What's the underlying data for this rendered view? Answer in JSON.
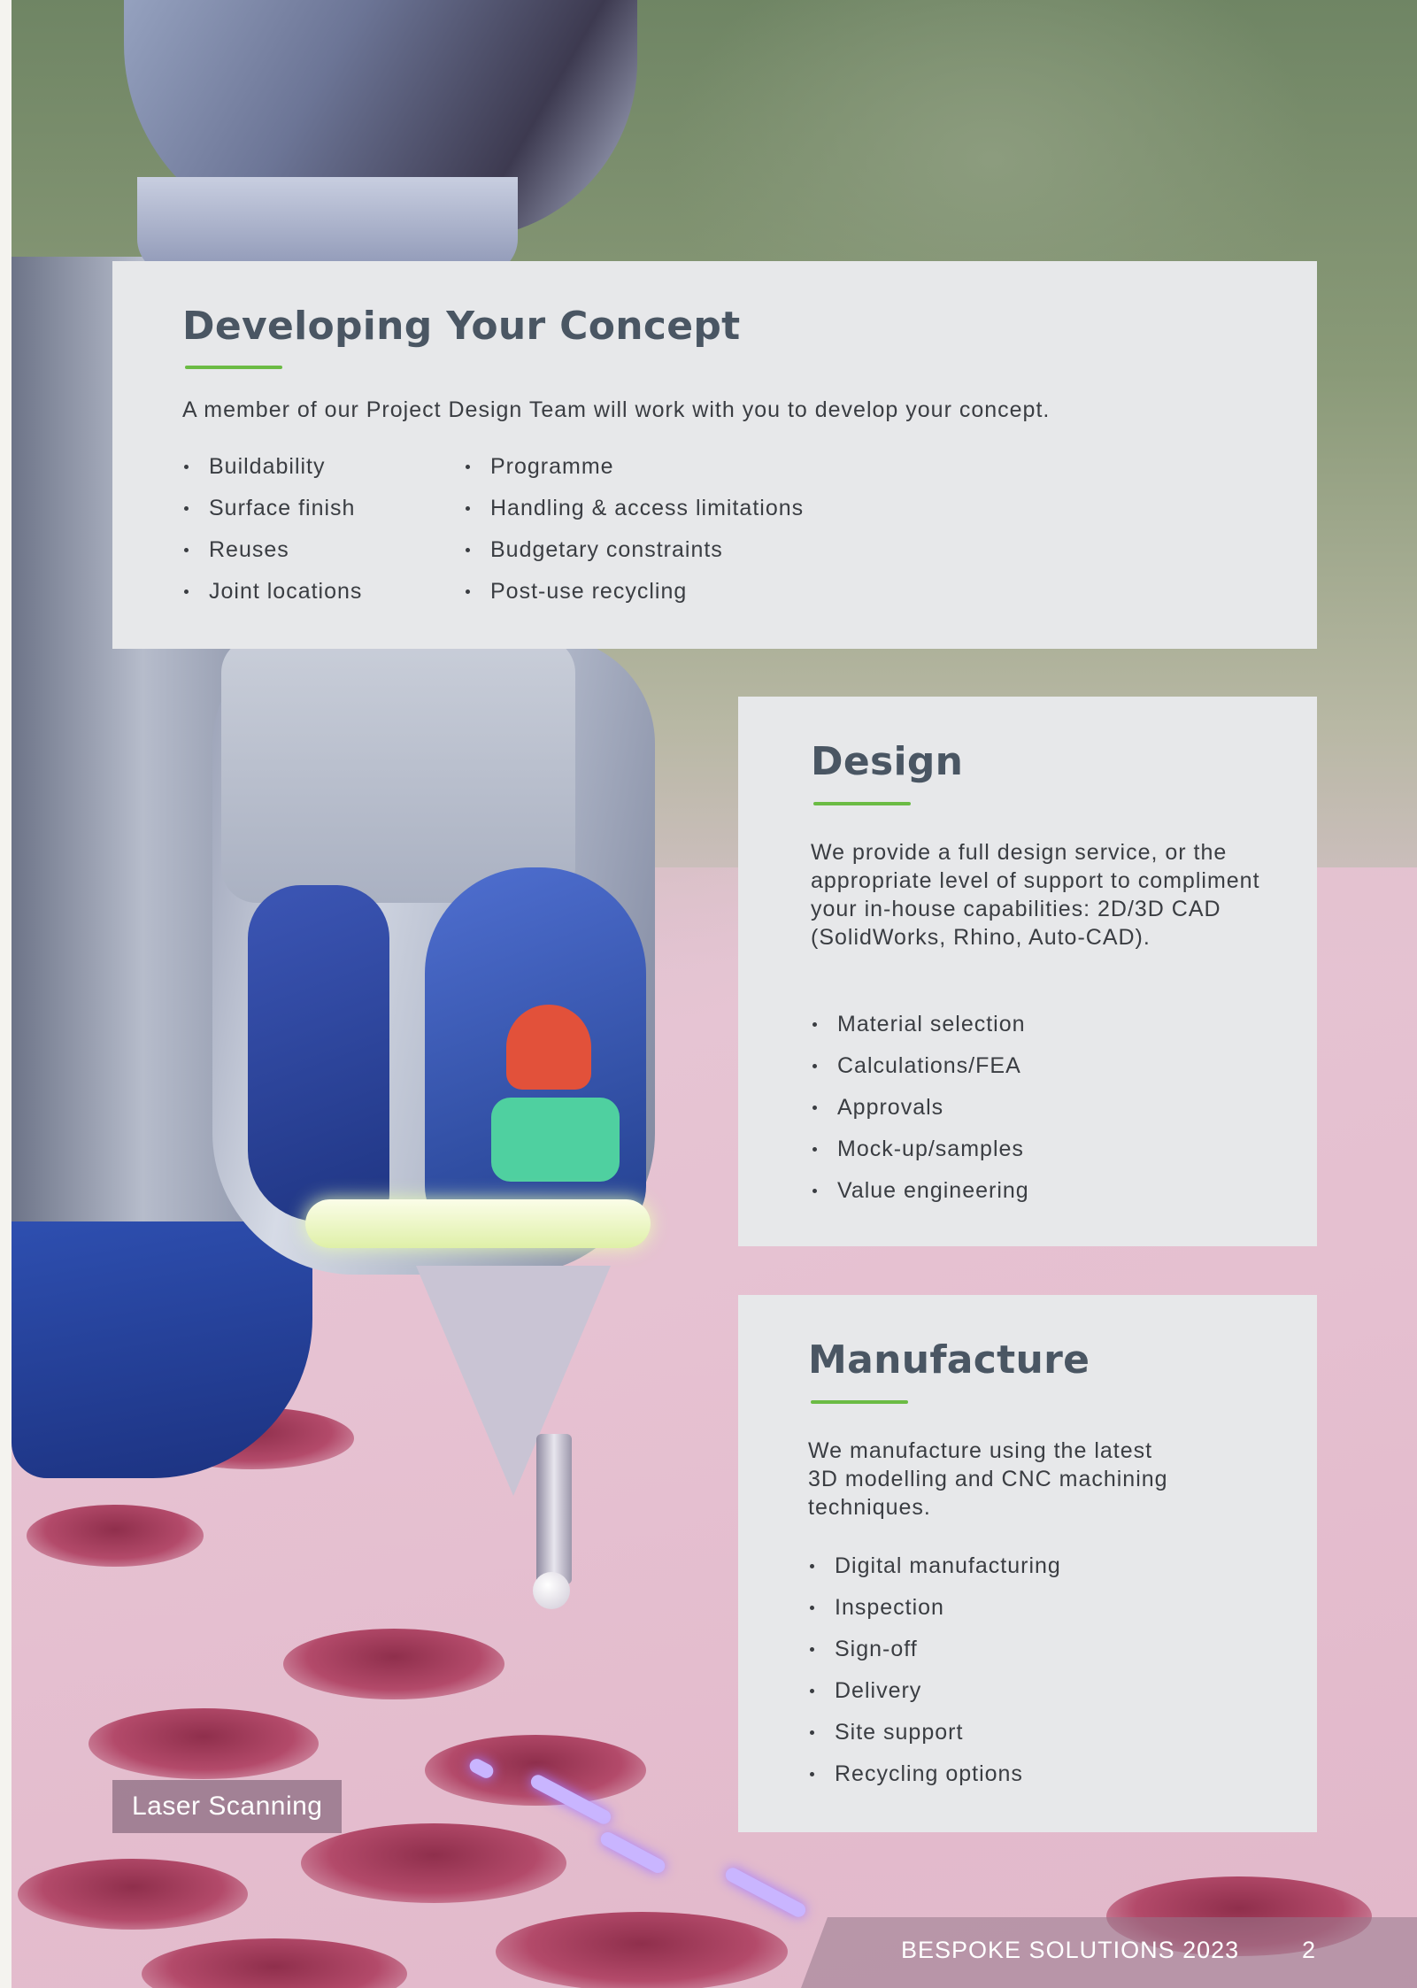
{
  "concept": {
    "title": "Developing Your Concept",
    "intro": "A member of our Project Design Team will work with you to develop your concept.",
    "list_left": [
      "Buildability",
      "Surface finish",
      "Reuses",
      "Joint locations"
    ],
    "list_right": [
      "Programme",
      "Handling & access limitations",
      "Budgetary constraints",
      "Post-use recycling"
    ]
  },
  "design": {
    "title": "Design",
    "intro": "We provide a full design service, or the appropriate level of support to compliment your in-house capabilities: 2D/3D CAD (SolidWorks, Rhino, Auto-CAD).",
    "items": [
      "Material selection",
      "Calculations/FEA",
      "Approvals",
      "Mock-up/samples",
      "Value engineering"
    ]
  },
  "manufacture": {
    "title": "Manufacture",
    "intro": "We manufacture using the latest 3D modelling and CNC machining techniques.",
    "items": [
      "Digital manufacturing",
      "Inspection",
      "Sign-off",
      "Delivery",
      "Site support",
      "Recycling options"
    ]
  },
  "caption": "Laser Scanning",
  "footer": {
    "title": "BESPOKE SOLUTIONS 2023",
    "page": "2"
  },
  "colors": {
    "accent_green": "#6bbb44",
    "heading": "#4a5663",
    "panel_bg": "#e7e8ea"
  }
}
